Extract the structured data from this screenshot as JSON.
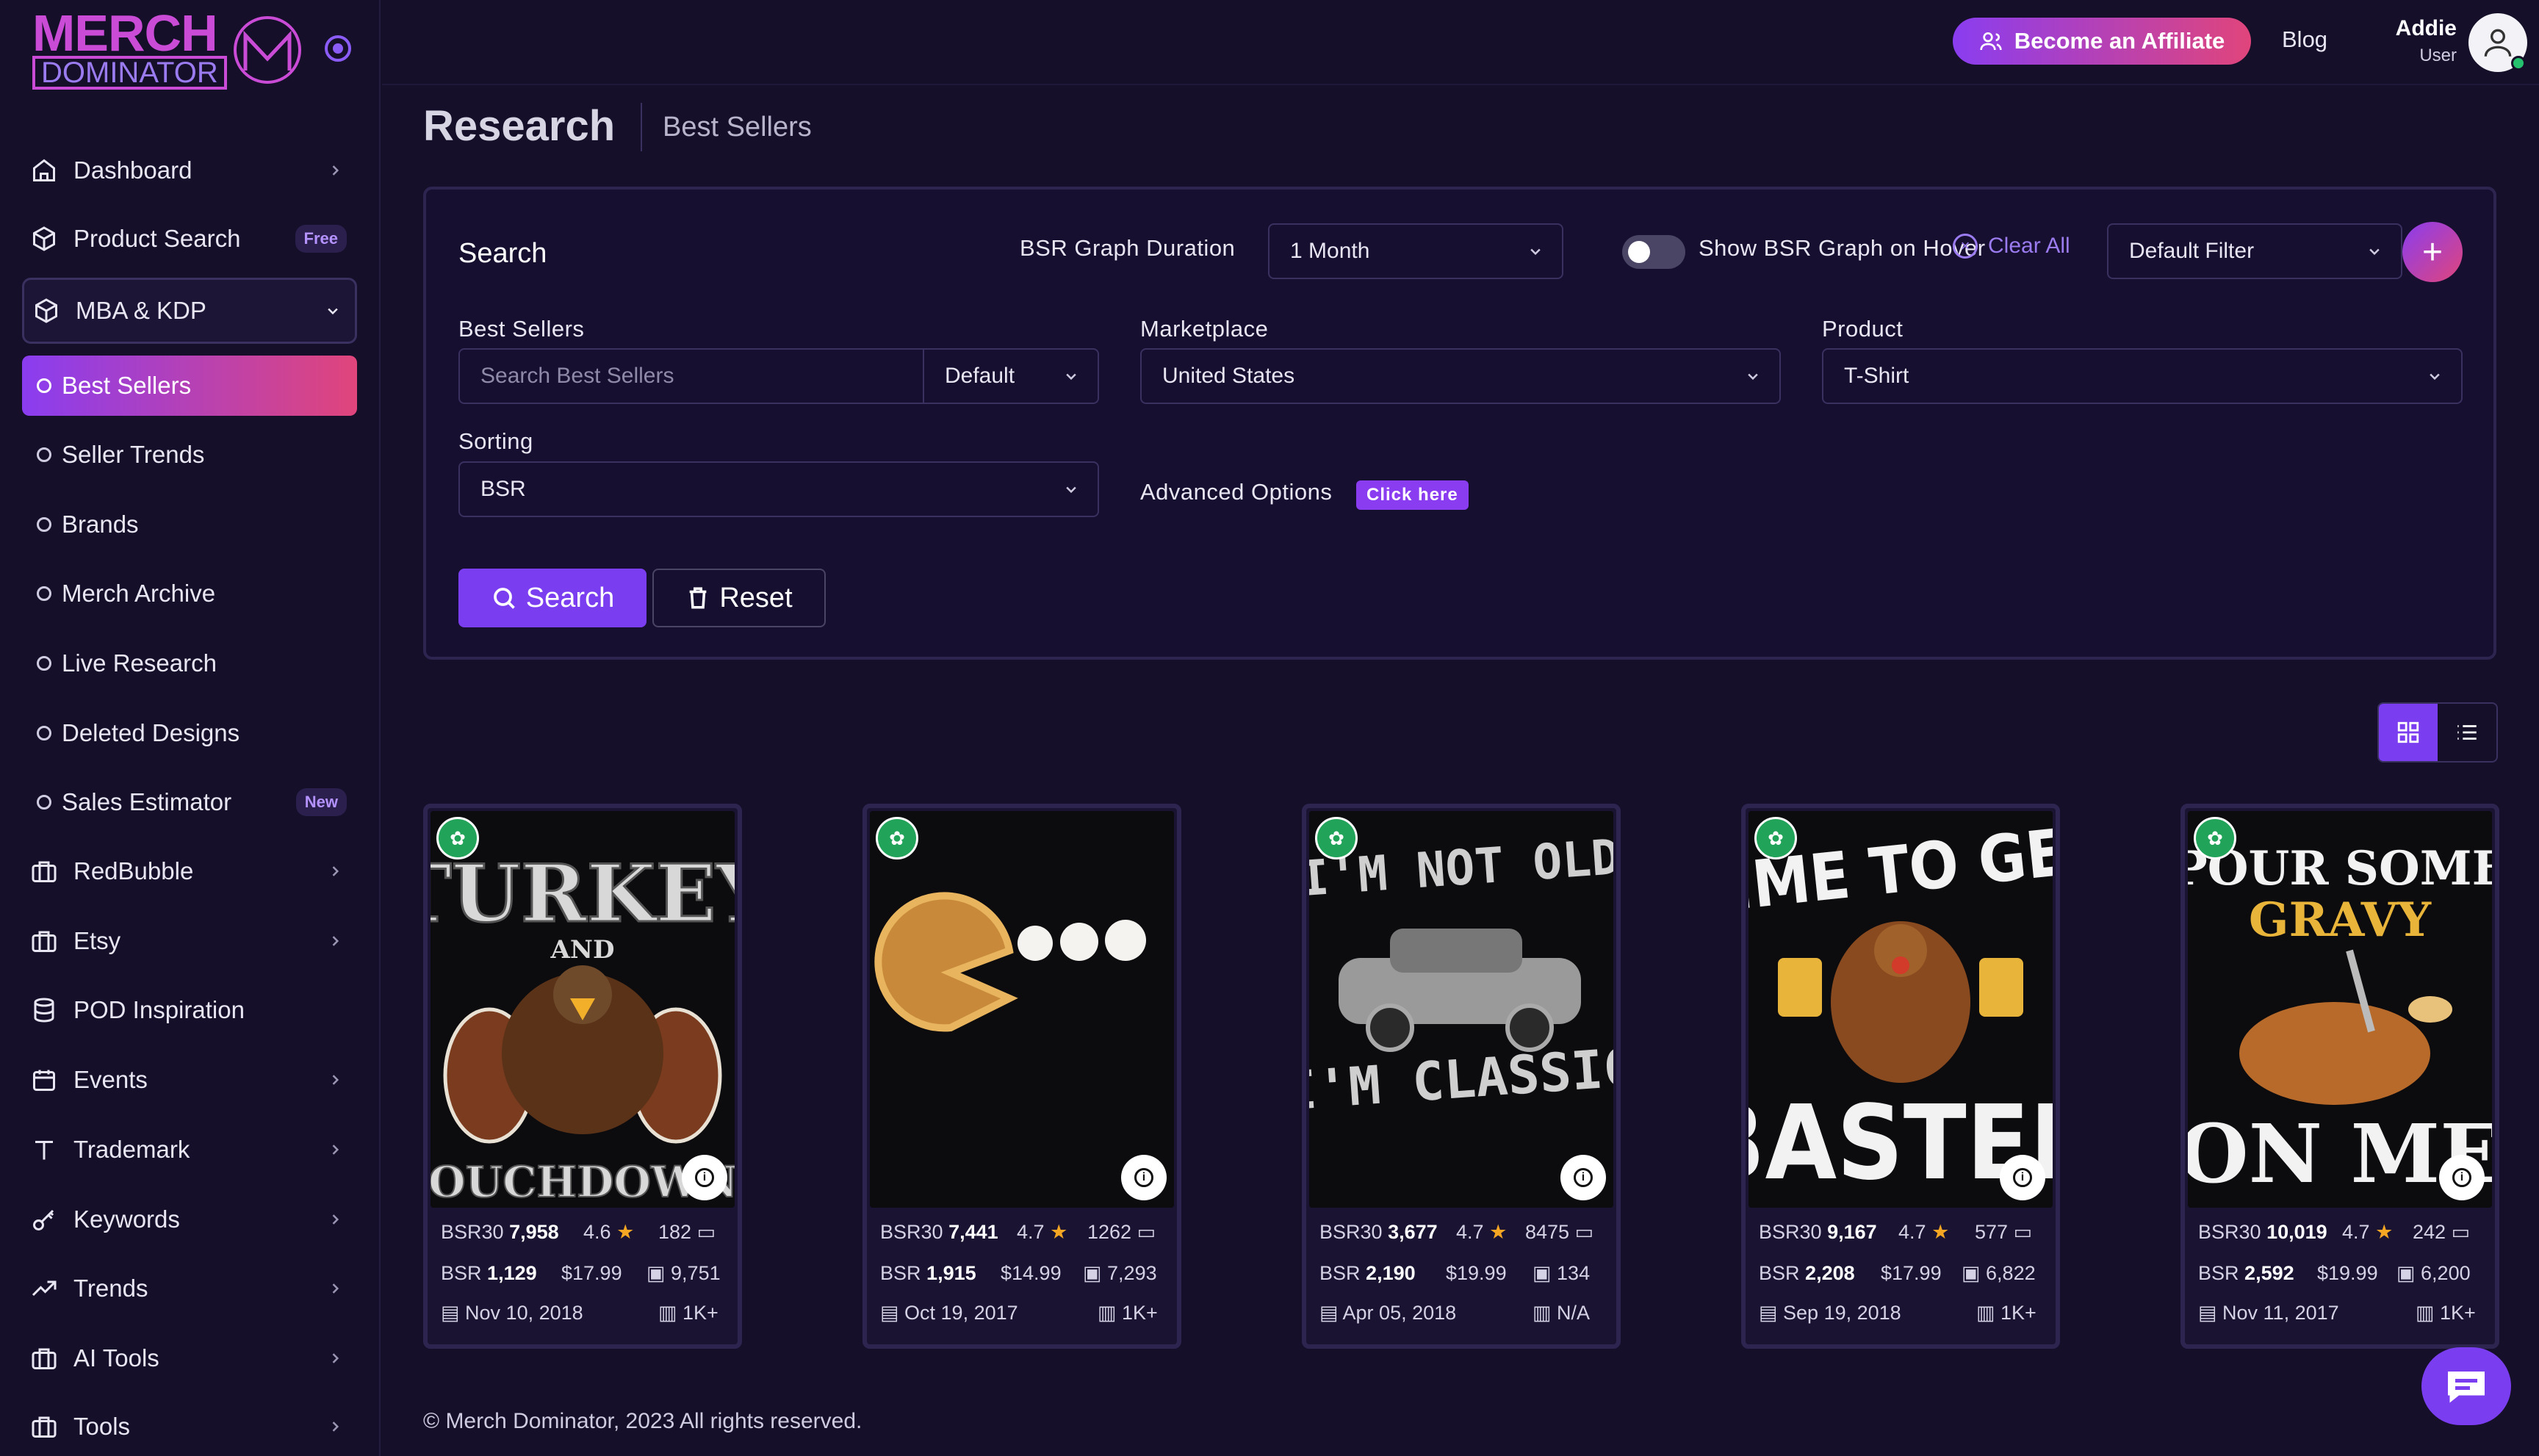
{
  "logo": {
    "line1": "MERCH",
    "line2": "DOMINATOR"
  },
  "sidebar": {
    "items": [
      {
        "label": "Dashboard",
        "icon": "home-icon"
      },
      {
        "label": "Product Search",
        "icon": "box-icon",
        "badge": "Free"
      },
      {
        "label": "MBA & KDP",
        "icon": "box-icon"
      },
      {
        "label": "RedBubble",
        "icon": "briefcase-icon"
      },
      {
        "label": "Etsy",
        "icon": "briefcase-icon"
      },
      {
        "label": "POD Inspiration",
        "icon": "database-icon"
      },
      {
        "label": "Events",
        "icon": "calendar-icon"
      },
      {
        "label": "Trademark",
        "icon": "type-icon"
      },
      {
        "label": "Keywords",
        "icon": "key-icon"
      },
      {
        "label": "Trends",
        "icon": "trending-up-icon"
      },
      {
        "label": "AI Tools",
        "icon": "briefcase-icon"
      },
      {
        "label": "Tools",
        "icon": "briefcase-icon"
      }
    ],
    "sub_items": [
      {
        "label": "Best Sellers",
        "active": true
      },
      {
        "label": "Seller Trends"
      },
      {
        "label": "Brands"
      },
      {
        "label": "Merch Archive"
      },
      {
        "label": "Live Research"
      },
      {
        "label": "Deleted Designs"
      },
      {
        "label": "Sales Estimator",
        "badge": "New"
      }
    ]
  },
  "topbar": {
    "affiliate_label": "Become an Affiliate",
    "blog_label": "Blog",
    "user_name": "Addie",
    "user_role": "User"
  },
  "page": {
    "title": "Research",
    "subtitle": "Best Sellers"
  },
  "search": {
    "title": "Search",
    "bsr_duration_label": "BSR Graph Duration",
    "bsr_duration_value": "1 Month",
    "hover_toggle_label": "Show BSR Graph on Hover",
    "clear_all_label": "Clear All",
    "filter_value": "Default Filter",
    "best_sellers_label": "Best Sellers",
    "best_sellers_placeholder": "Search Best Sellers",
    "best_sellers_mode": "Default",
    "marketplace_label": "Marketplace",
    "marketplace_value": "United States",
    "product_label": "Product",
    "product_value": "T-Shirt",
    "sorting_label": "Sorting",
    "sorting_value": "BSR",
    "advanced_label": "Advanced Options",
    "advanced_link": "Click here",
    "search_button": "Search",
    "reset_button": "Reset"
  },
  "products": [
    {
      "bsr30_label": "BSR30",
      "bsr30": "7,958",
      "rating": "4.6",
      "reviews": "182",
      "bsr_label": "BSR",
      "bsr": "1,129",
      "price": "$17.99",
      "sales": "9,751",
      "date": "Nov 10, 2018",
      "est": "1K+"
    },
    {
      "bsr30_label": "BSR30",
      "bsr30": "7,441",
      "rating": "4.7",
      "reviews": "1262",
      "bsr_label": "BSR",
      "bsr": "1,915",
      "price": "$14.99",
      "sales": "7,293",
      "date": "Oct 19, 2017",
      "est": "1K+"
    },
    {
      "bsr30_label": "BSR30",
      "bsr30": "3,677",
      "rating": "4.7",
      "reviews": "8475",
      "bsr_label": "BSR",
      "bsr": "2,190",
      "price": "$19.99",
      "sales": "134",
      "date": "Apr 05, 2018",
      "est": "N/A"
    },
    {
      "bsr30_label": "BSR30",
      "bsr30": "9,167",
      "rating": "4.7",
      "reviews": "577",
      "bsr_label": "BSR",
      "bsr": "2,208",
      "price": "$17.99",
      "sales": "6,822",
      "date": "Sep 19, 2018",
      "est": "1K+"
    },
    {
      "bsr30_label": "BSR30",
      "bsr30": "10,019",
      "rating": "4.7",
      "reviews": "242",
      "bsr_label": "BSR",
      "bsr": "2,592",
      "price": "$19.99",
      "sales": "6,200",
      "date": "Nov 11, 2017",
      "est": "1K+"
    }
  ],
  "footer": {
    "text": "© Merch Dominator, 2023 All rights reserved."
  },
  "colors": {
    "accent_purple": "#8a3df0",
    "accent_pink": "#e0457b",
    "background": "#150f2a"
  }
}
